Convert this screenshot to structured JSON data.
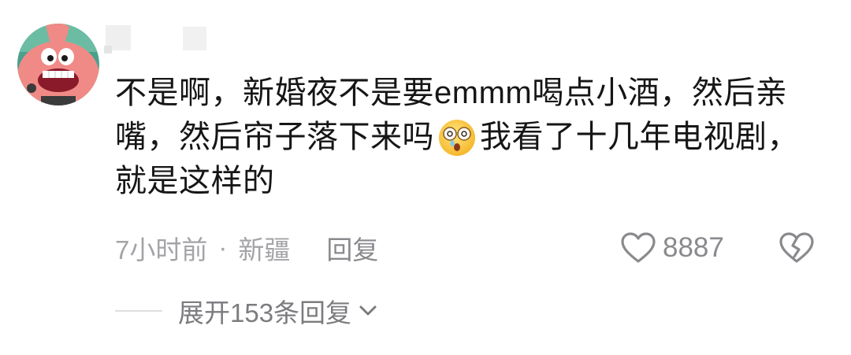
{
  "comment": {
    "avatar_icon": "cartoon-avatar-icon",
    "text_part1": "不是啊，新婚夜不是要emmm喝点小酒，然后亲嘴，然后帘子落下来吗",
    "emoji_icon": "surprised-face-icon",
    "text_part2": "我看了十几年电视剧，就是这样的",
    "time": "7小时前",
    "separator": "·",
    "location": "新疆",
    "reply_label": "回复",
    "like_icon": "heart-outline-icon",
    "like_count": "8887",
    "dislike_icon": "broken-heart-icon"
  },
  "replies": {
    "expand_label": "展开153条回复",
    "expand_icon": "chevron-down-icon"
  }
}
